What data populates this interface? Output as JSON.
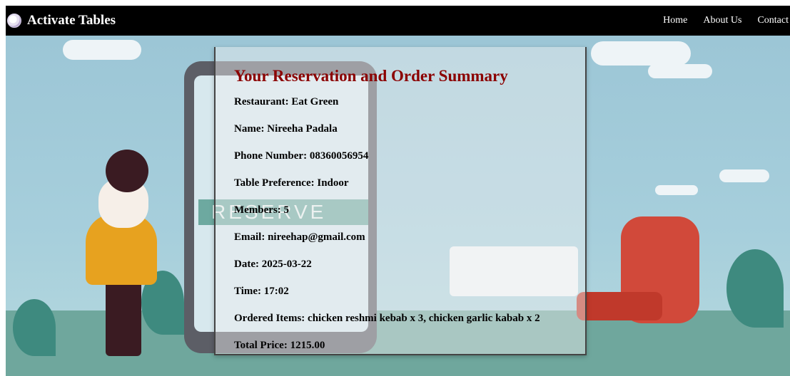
{
  "brand": {
    "title": "Activate Tables",
    "icon": "plate-icon"
  },
  "nav": {
    "home": "Home",
    "about": "About Us",
    "contact": "Contact"
  },
  "background": {
    "button_text": "RESERVE"
  },
  "summary": {
    "heading": "Your Reservation and Order Summary",
    "restaurant": "Restaurant: Eat Green",
    "name": "Name: Nireeha Padala",
    "phone": "Phone Number: 08360056954",
    "table_preference": "Table Preference: Indoor",
    "members": "Members: 5",
    "email": "Email: nireehap@gmail.com",
    "date": "Date: 2025-03-22",
    "time": "Time: 17:02",
    "ordered_items": "Ordered Items: chicken reshmi kebab x 3, chicken garlic kabab x 2",
    "total_price": "Total Price: 1215.00"
  },
  "colors": {
    "navbar": "#000000",
    "heading": "#8b0000",
    "sky": "#9cc6d6",
    "floor": "#6fa79d"
  }
}
